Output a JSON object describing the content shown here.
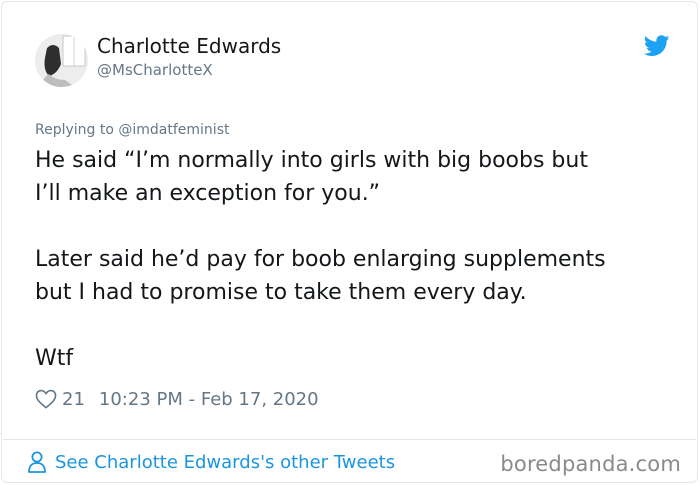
{
  "tweet": {
    "author": {
      "display_name": "Charlotte Edwards",
      "handle": "@MsCharlotteX"
    },
    "reply_to": "Replying to @imdatfeminist",
    "body": {
      "paragraph1_line1": "He said “I’m normally into girls with big boobs but",
      "paragraph1_line2": "I’ll make an exception for you.”",
      "paragraph2_line1": "Later said he’d pay for boob enlarging supplements",
      "paragraph2_line2": "but I had to promise to take them every day.",
      "paragraph3": "Wtf"
    },
    "likes": "21",
    "timestamp": "10:23 PM - Feb 17, 2020"
  },
  "footer": {
    "other_tweets_link": "See Charlotte Edwards's other Tweets",
    "watermark": "boredpanda.com"
  },
  "icons": {
    "brand": "twitter-bird-icon",
    "like": "heart-icon",
    "profile": "person-icon"
  },
  "colors": {
    "twitter_blue": "#1da1f2",
    "link_blue": "#1b95e0",
    "muted": "#657786",
    "text": "#14171a",
    "border": "#e1e8ed"
  }
}
